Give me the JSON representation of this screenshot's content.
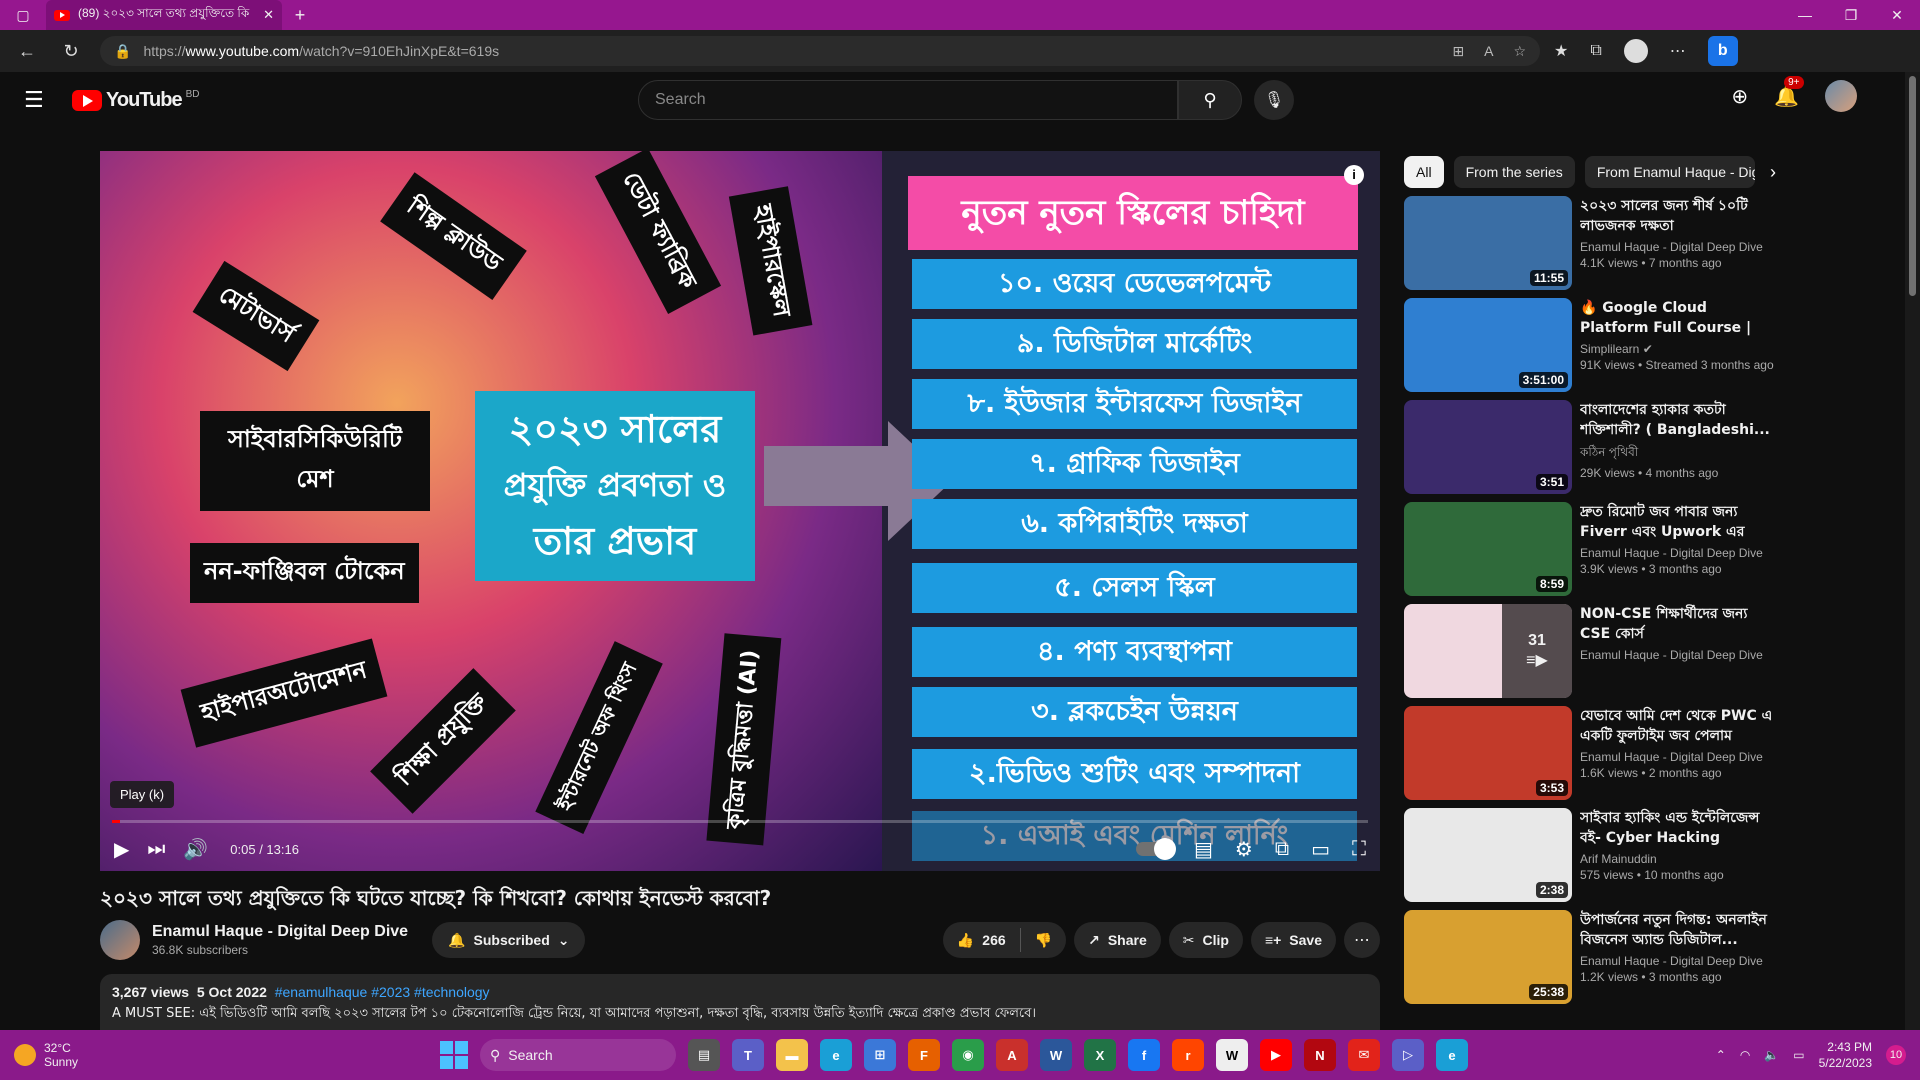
{
  "browser": {
    "tab_title": "(89) ২০২৩ সালে তথ্য প্রযুক্তিতে কি",
    "url_prefix": "https://",
    "url_host": "www.youtube.com",
    "url_path": "/watch?v=910EhJinXpE&t=619s"
  },
  "masthead": {
    "logo_text": "YouTube",
    "country_code": "BD",
    "search_placeholder": "Search",
    "notification_count": "9+"
  },
  "video": {
    "slide": {
      "center_line1": "২০২৩ সালের",
      "center_line2": "প্রযুক্তি প্রবণতা ও",
      "center_line3": "তার প্রভাব",
      "arrows": [
        "শিল্প ক্লাউড",
        "ডেটা ফ্যাব্রিক",
        "হাইপারস্কেল",
        "মেটাভার্স",
        "সাইবারসিকিউরিটি মেশ",
        "নন-ফাঞ্জিবল টোকেন",
        "হাইপারঅটোমেশন",
        "শিক্ষা প্রযুক্তি",
        "ইন্টারনেট অফ থিংস",
        "কৃত্রিম বুদ্ধিমত্তা (AI)"
      ],
      "skills_title": "নুতন নুতন স্কিলের চাহিদা",
      "skills": [
        "১০. ওয়েব ডেভেলপমেন্ট",
        "৯. ডিজিটাল মার্কেটিং",
        "৮. ইউজার ইন্টারফেস ডিজাইন",
        "৭. গ্রাফিক ডিজাইন",
        "৬. কপিরাইটিং দক্ষতা",
        "৫. সেলস স্কিল",
        "৪. পণ্য ব্যবস্থাপনা",
        "৩. ব্লকচেইন উন্নয়ন",
        "২.ভিডিও শুটিং এবং সম্পাদনা",
        "১. এআই এবং মেশিন লার্নিং"
      ]
    },
    "tooltip": "Play (k)",
    "time": "0:05 / 13:16",
    "progress": 0.006,
    "title": "২০২৩ সালে তথ্য প্রযুক্তিতে কি ঘটতে যাচ্ছে? কি শিখবো? কোথায় ইনভেস্ট করবো?",
    "channel": "Enamul Haque - Digital Deep Dive",
    "subscribers": "36.8K subscribers",
    "subscribed_label": "Subscribed",
    "likes": "266",
    "share_label": "Share",
    "clip_label": "Clip",
    "save_label": "Save",
    "views": "3,267 views",
    "date": "5 Oct 2022",
    "hashtags": "#enamulhaque #2023 #technology",
    "description": "A MUST SEE: এই ভিডিওটি আমি বলছি ২০২৩ সালের টপ ১০ টেকনোলোজি ট্রেন্ড নিয়ে, যা আমাদের পড়াশুনা, দক্ষতা বৃদ্ধি, ব্যবসায় উন্নতি ইত্যাদি ক্ষেত্রে প্রকাণ্ড প্রভাব ফেলবে।"
  },
  "sidebar": {
    "chips": [
      "All",
      "From the series",
      "From Enamul Haque - Digi"
    ],
    "recommendations": [
      {
        "title": "২০২৩ সালের জন্য শীর্ষ ১০টি লাভজনক দক্ষতা",
        "channel": "Enamul Haque - Digital Deep Dive",
        "meta": "4.1K views • 7 months ago",
        "duration": "11:55",
        "color": "#3a6ea5"
      },
      {
        "title": "🔥 Google Cloud Platform Full Course | Google Cloud Platfor...",
        "channel": "Simplilearn ✔",
        "meta": "91K views • Streamed 3 months ago",
        "duration": "3:51:00",
        "color": "#2f7fd1"
      },
      {
        "title": "বাংলাদেশের হ্যাকার কতটা শক্তিশালী? ( Bangladeshi...",
        "channel": "কঠিন পৃথিবী",
        "meta": "29K views • 4 months ago",
        "duration": "3:51",
        "color": "#3b2a6b"
      },
      {
        "title": "দ্রুত রিমোট জব পাবার জন্য Fiverr এবং Upwork এর বিকল্প...",
        "channel": "Enamul Haque - Digital Deep Dive",
        "meta": "3.9K views • 3 months ago",
        "duration": "8:59",
        "color": "#2f6a3a"
      },
      {
        "title": "NON-CSE শিক্ষার্থীদের জন্য CSE কোর্স",
        "channel": "Enamul Haque - Digital Deep Dive",
        "meta": "",
        "duration": "",
        "playlist_count": "31",
        "color": "#f0d8e0"
      },
      {
        "title": "যেভাবে আমি দেশ থেকে PWC এ একটি ফুলটাইম জব পেলাম",
        "channel": "Enamul Haque - Digital Deep Dive",
        "meta": "1.6K views • 2 months ago",
        "duration": "3:53",
        "color": "#c23a2a"
      },
      {
        "title": "সাইবার হ্যাকিং এন্ড ইন্টেলিজেন্স বই- Cyber Hacking Intelligenc...",
        "channel": "Arif Mainuddin",
        "meta": "575 views • 10 months ago",
        "duration": "2:38",
        "color": "#e8e8e8"
      },
      {
        "title": "উপার্জনের নতুন দিগন্ত: অনলাইন বিজনেস অ্যান্ড ডিজিটাল...",
        "channel": "Enamul Haque - Digital Deep Dive",
        "meta": "1.2K views • 3 months ago",
        "duration": "25:38",
        "color": "#d8a030"
      }
    ]
  },
  "taskbar": {
    "temp": "32°C",
    "weather": "Sunny",
    "search_label": "Search",
    "time": "2:43 PM",
    "date": "5/22/2023",
    "notifications": "10"
  }
}
